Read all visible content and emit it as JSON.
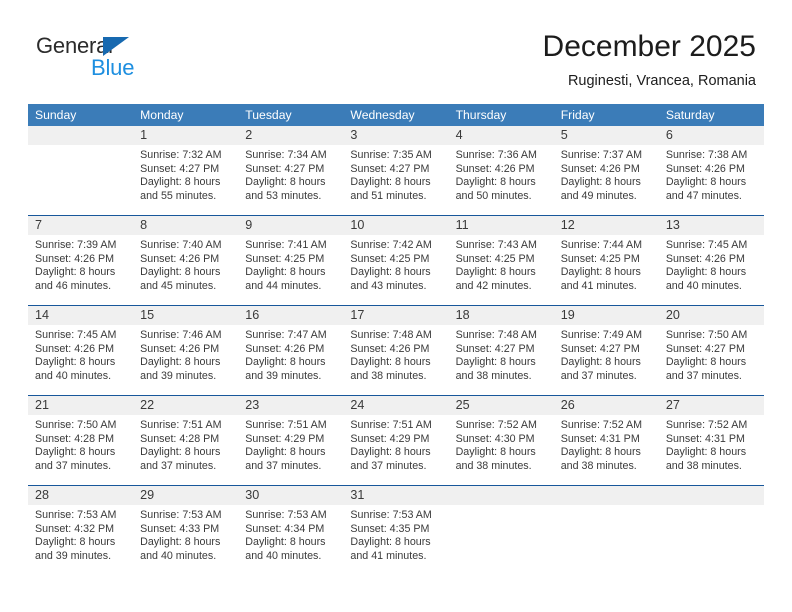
{
  "brand": {
    "name_part1": "General",
    "name_part2": "Blue",
    "logo_icon": "triangle-logo-icon"
  },
  "header": {
    "title": "December 2025",
    "location": "Ruginesti, Vrancea, Romania"
  },
  "colors": {
    "header_blue": "#3b7cb8",
    "week_divider_blue": "#18579b",
    "brand_dark": "#2b2b2b",
    "brand_blue": "#1e8fe0",
    "numbers_row_bg": "#f0f0f0"
  },
  "weekday_headers": [
    "Sunday",
    "Monday",
    "Tuesday",
    "Wednesday",
    "Thursday",
    "Friday",
    "Saturday"
  ],
  "weeks": [
    {
      "days": [
        {
          "number": "",
          "lines": []
        },
        {
          "number": "1",
          "lines": [
            "Sunrise: 7:32 AM",
            "Sunset: 4:27 PM",
            "Daylight: 8 hours",
            "and 55 minutes."
          ]
        },
        {
          "number": "2",
          "lines": [
            "Sunrise: 7:34 AM",
            "Sunset: 4:27 PM",
            "Daylight: 8 hours",
            "and 53 minutes."
          ]
        },
        {
          "number": "3",
          "lines": [
            "Sunrise: 7:35 AM",
            "Sunset: 4:27 PM",
            "Daylight: 8 hours",
            "and 51 minutes."
          ]
        },
        {
          "number": "4",
          "lines": [
            "Sunrise: 7:36 AM",
            "Sunset: 4:26 PM",
            "Daylight: 8 hours",
            "and 50 minutes."
          ]
        },
        {
          "number": "5",
          "lines": [
            "Sunrise: 7:37 AM",
            "Sunset: 4:26 PM",
            "Daylight: 8 hours",
            "and 49 minutes."
          ]
        },
        {
          "number": "6",
          "lines": [
            "Sunrise: 7:38 AM",
            "Sunset: 4:26 PM",
            "Daylight: 8 hours",
            "and 47 minutes."
          ]
        }
      ]
    },
    {
      "days": [
        {
          "number": "7",
          "lines": [
            "Sunrise: 7:39 AM",
            "Sunset: 4:26 PM",
            "Daylight: 8 hours",
            "and 46 minutes."
          ]
        },
        {
          "number": "8",
          "lines": [
            "Sunrise: 7:40 AM",
            "Sunset: 4:26 PM",
            "Daylight: 8 hours",
            "and 45 minutes."
          ]
        },
        {
          "number": "9",
          "lines": [
            "Sunrise: 7:41 AM",
            "Sunset: 4:25 PM",
            "Daylight: 8 hours",
            "and 44 minutes."
          ]
        },
        {
          "number": "10",
          "lines": [
            "Sunrise: 7:42 AM",
            "Sunset: 4:25 PM",
            "Daylight: 8 hours",
            "and 43 minutes."
          ]
        },
        {
          "number": "11",
          "lines": [
            "Sunrise: 7:43 AM",
            "Sunset: 4:25 PM",
            "Daylight: 8 hours",
            "and 42 minutes."
          ]
        },
        {
          "number": "12",
          "lines": [
            "Sunrise: 7:44 AM",
            "Sunset: 4:25 PM",
            "Daylight: 8 hours",
            "and 41 minutes."
          ]
        },
        {
          "number": "13",
          "lines": [
            "Sunrise: 7:45 AM",
            "Sunset: 4:26 PM",
            "Daylight: 8 hours",
            "and 40 minutes."
          ]
        }
      ]
    },
    {
      "days": [
        {
          "number": "14",
          "lines": [
            "Sunrise: 7:45 AM",
            "Sunset: 4:26 PM",
            "Daylight: 8 hours",
            "and 40 minutes."
          ]
        },
        {
          "number": "15",
          "lines": [
            "Sunrise: 7:46 AM",
            "Sunset: 4:26 PM",
            "Daylight: 8 hours",
            "and 39 minutes."
          ]
        },
        {
          "number": "16",
          "lines": [
            "Sunrise: 7:47 AM",
            "Sunset: 4:26 PM",
            "Daylight: 8 hours",
            "and 39 minutes."
          ]
        },
        {
          "number": "17",
          "lines": [
            "Sunrise: 7:48 AM",
            "Sunset: 4:26 PM",
            "Daylight: 8 hours",
            "and 38 minutes."
          ]
        },
        {
          "number": "18",
          "lines": [
            "Sunrise: 7:48 AM",
            "Sunset: 4:27 PM",
            "Daylight: 8 hours",
            "and 38 minutes."
          ]
        },
        {
          "number": "19",
          "lines": [
            "Sunrise: 7:49 AM",
            "Sunset: 4:27 PM",
            "Daylight: 8 hours",
            "and 37 minutes."
          ]
        },
        {
          "number": "20",
          "lines": [
            "Sunrise: 7:50 AM",
            "Sunset: 4:27 PM",
            "Daylight: 8 hours",
            "and 37 minutes."
          ]
        }
      ]
    },
    {
      "days": [
        {
          "number": "21",
          "lines": [
            "Sunrise: 7:50 AM",
            "Sunset: 4:28 PM",
            "Daylight: 8 hours",
            "and 37 minutes."
          ]
        },
        {
          "number": "22",
          "lines": [
            "Sunrise: 7:51 AM",
            "Sunset: 4:28 PM",
            "Daylight: 8 hours",
            "and 37 minutes."
          ]
        },
        {
          "number": "23",
          "lines": [
            "Sunrise: 7:51 AM",
            "Sunset: 4:29 PM",
            "Daylight: 8 hours",
            "and 37 minutes."
          ]
        },
        {
          "number": "24",
          "lines": [
            "Sunrise: 7:51 AM",
            "Sunset: 4:29 PM",
            "Daylight: 8 hours",
            "and 37 minutes."
          ]
        },
        {
          "number": "25",
          "lines": [
            "Sunrise: 7:52 AM",
            "Sunset: 4:30 PM",
            "Daylight: 8 hours",
            "and 38 minutes."
          ]
        },
        {
          "number": "26",
          "lines": [
            "Sunrise: 7:52 AM",
            "Sunset: 4:31 PM",
            "Daylight: 8 hours",
            "and 38 minutes."
          ]
        },
        {
          "number": "27",
          "lines": [
            "Sunrise: 7:52 AM",
            "Sunset: 4:31 PM",
            "Daylight: 8 hours",
            "and 38 minutes."
          ]
        }
      ]
    },
    {
      "days": [
        {
          "number": "28",
          "lines": [
            "Sunrise: 7:53 AM",
            "Sunset: 4:32 PM",
            "Daylight: 8 hours",
            "and 39 minutes."
          ]
        },
        {
          "number": "29",
          "lines": [
            "Sunrise: 7:53 AM",
            "Sunset: 4:33 PM",
            "Daylight: 8 hours",
            "and 40 minutes."
          ]
        },
        {
          "number": "30",
          "lines": [
            "Sunrise: 7:53 AM",
            "Sunset: 4:34 PM",
            "Daylight: 8 hours",
            "and 40 minutes."
          ]
        },
        {
          "number": "31",
          "lines": [
            "Sunrise: 7:53 AM",
            "Sunset: 4:35 PM",
            "Daylight: 8 hours",
            "and 41 minutes."
          ]
        },
        {
          "number": "",
          "lines": []
        },
        {
          "number": "",
          "lines": []
        },
        {
          "number": "",
          "lines": []
        }
      ]
    }
  ]
}
